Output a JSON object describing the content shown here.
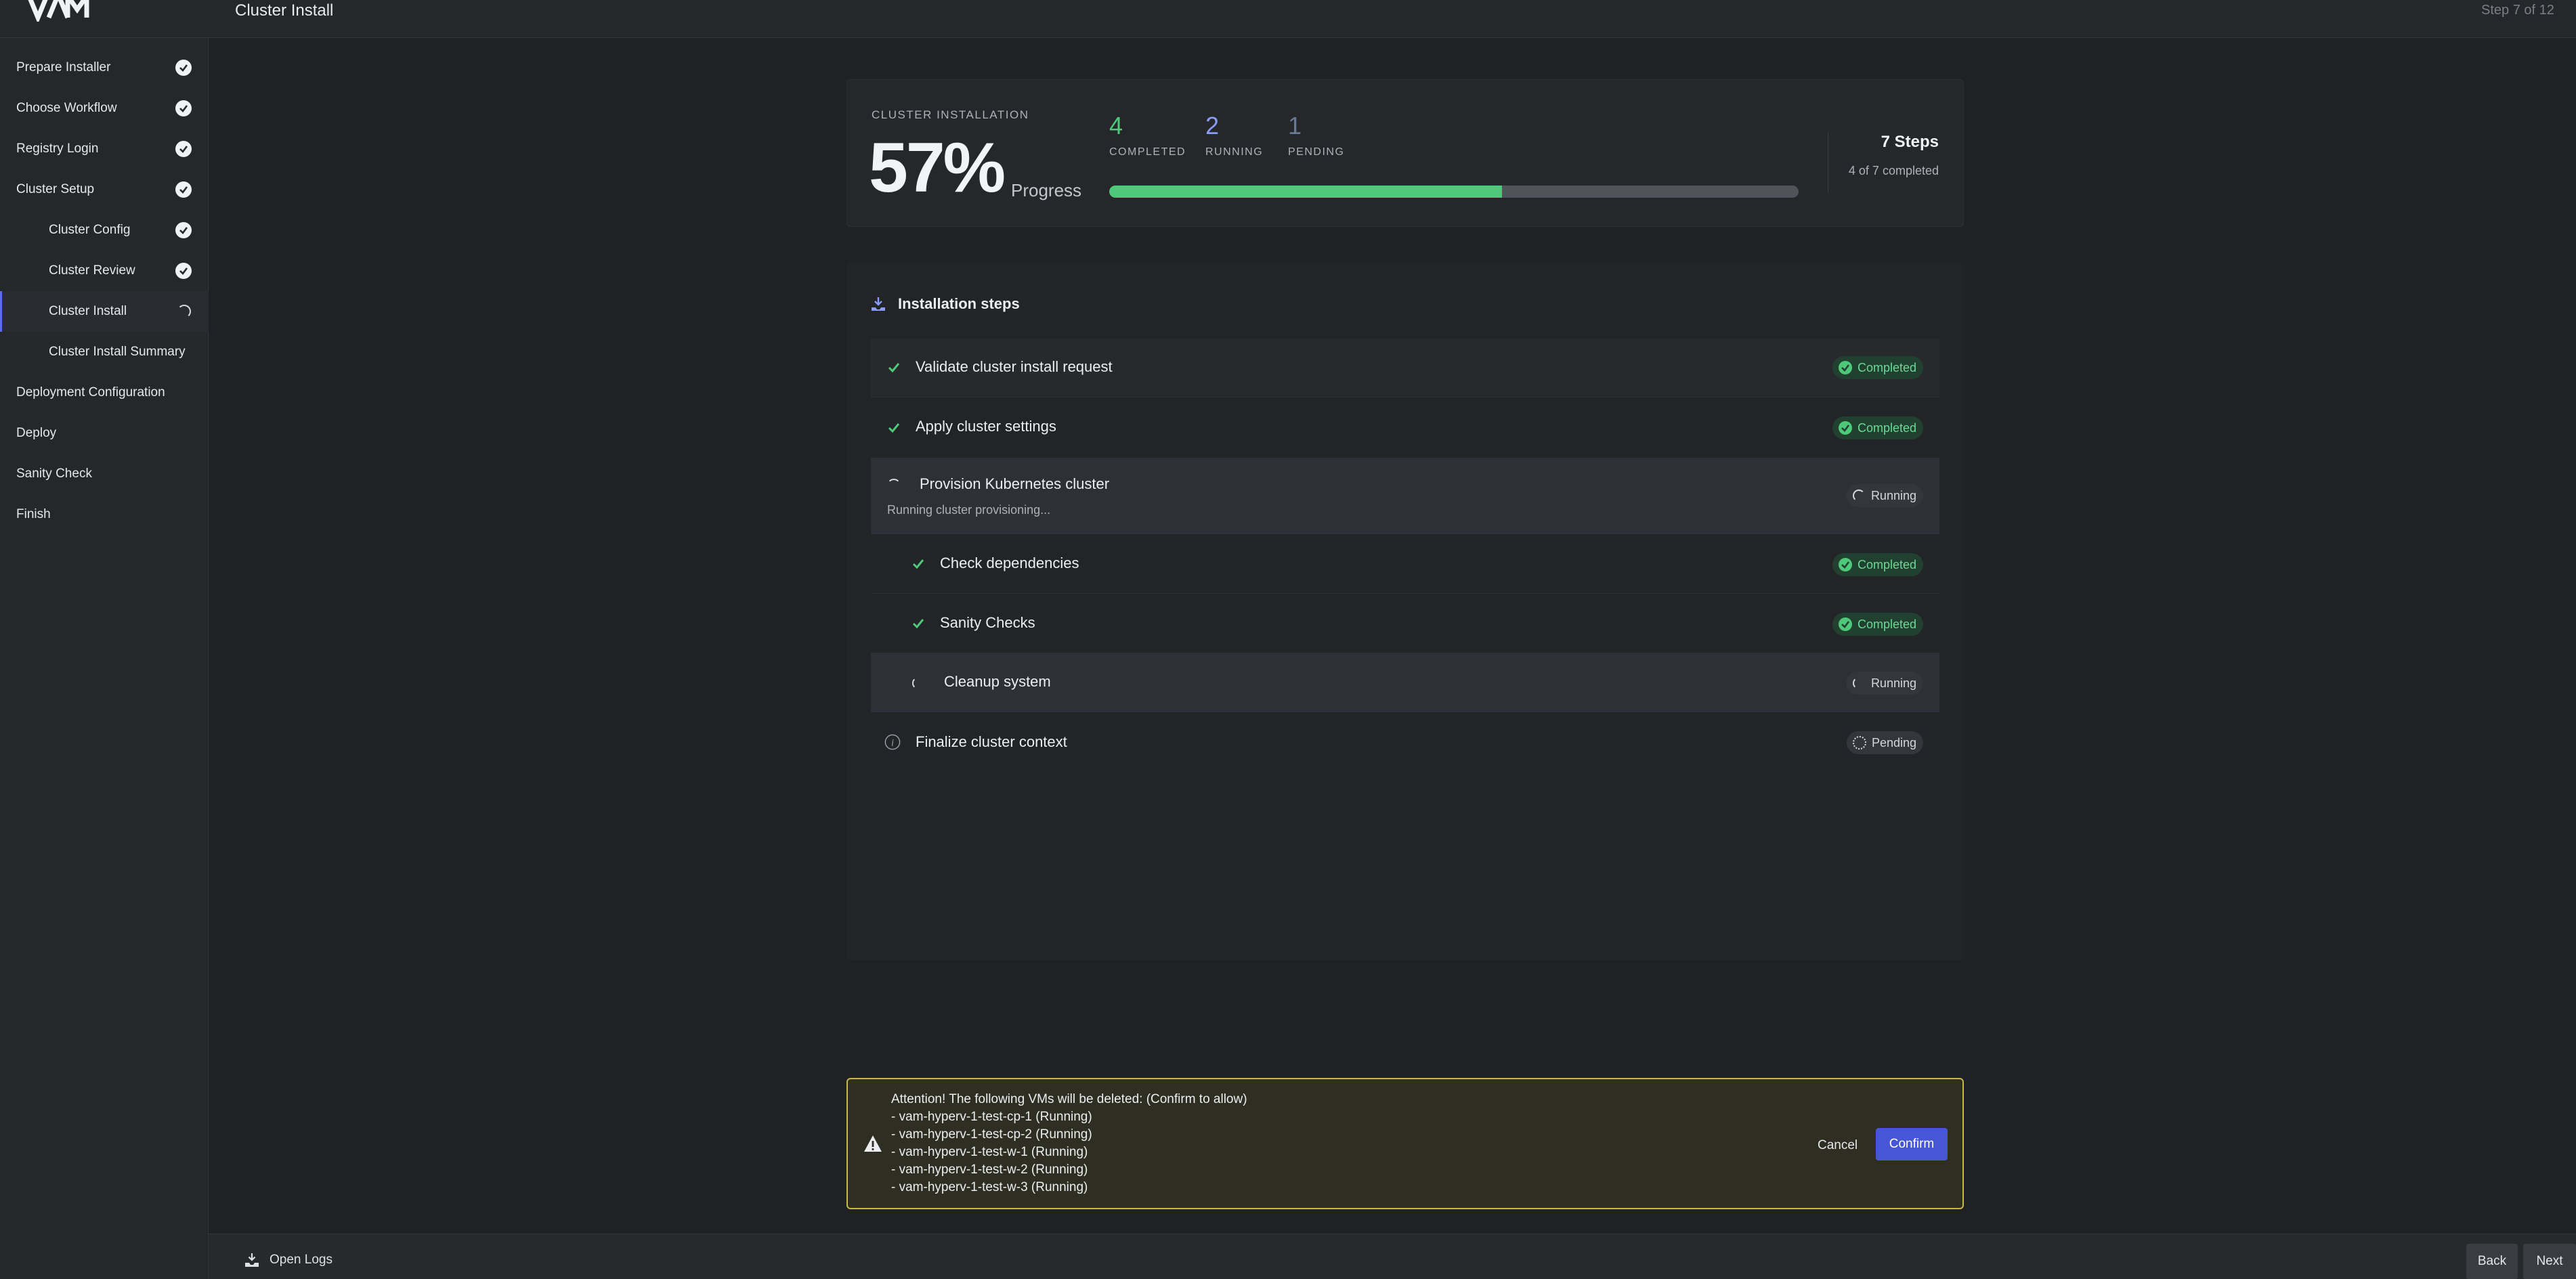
{
  "app": {
    "logo_text": "VAM"
  },
  "header": {
    "title": "Cluster Install",
    "step_counter": "Step 7 of 12"
  },
  "sidebar": {
    "items": [
      {
        "label": "Prepare Installer",
        "status": "completed"
      },
      {
        "label": "Choose Workflow",
        "status": "completed"
      },
      {
        "label": "Registry Login",
        "status": "completed"
      },
      {
        "label": "Cluster Setup",
        "status": "completed"
      },
      {
        "label": "Cluster Config",
        "status": "completed"
      },
      {
        "label": "Cluster Review",
        "status": "completed"
      },
      {
        "label": "Cluster Install",
        "status": "running"
      },
      {
        "label": "Cluster Install Summary",
        "status": "none"
      },
      {
        "label": "Deployment Configuration",
        "status": "none"
      },
      {
        "label": "Deploy",
        "status": "none"
      },
      {
        "label": "Sanity Check",
        "status": "none"
      },
      {
        "label": "Finish",
        "status": "none"
      }
    ]
  },
  "progress": {
    "eyebrow": "CLUSTER INSTALLATION",
    "percent": "57%",
    "percent_value": 57,
    "progress_word": "Progress",
    "completed_count": "4",
    "completed_label": "COMPLETED",
    "running_count": "2",
    "running_label": "RUNNING",
    "pending_count": "1",
    "pending_label": "PENDING",
    "total_steps": "7 Steps",
    "completed_summary": "4 of 7 completed"
  },
  "steps": {
    "title": "Installation steps",
    "items": [
      {
        "name": "Validate cluster install request",
        "status": "Completed"
      },
      {
        "name": "Apply cluster settings",
        "status": "Completed"
      },
      {
        "name": "Provision Kubernetes cluster",
        "status": "Running",
        "detail": "Running cluster provisioning..."
      },
      {
        "name": "Check dependencies",
        "status": "Completed"
      },
      {
        "name": "Sanity Checks",
        "status": "Completed"
      },
      {
        "name": "Cleanup system",
        "status": "Running"
      },
      {
        "name": "Finalize cluster context",
        "status": "Pending"
      }
    ]
  },
  "alert": {
    "lines": [
      "Attention! The following VMs will be deleted: (Confirm to allow)",
      "- vam-hyperv-1-test-cp-1 (Running)",
      "- vam-hyperv-1-test-cp-2 (Running)",
      "- vam-hyperv-1-test-w-1 (Running)",
      "- vam-hyperv-1-test-w-2 (Running)",
      "- vam-hyperv-1-test-w-3 (Running)"
    ],
    "cancel_label": "Cancel",
    "confirm_label": "Confirm"
  },
  "footer": {
    "open_logs_label": "Open Logs",
    "back_label": "Back",
    "next_label": "Next"
  },
  "colors": {
    "accent": "#5b6cf0",
    "success": "#4ec97a",
    "running": "#8a9cf5",
    "pending": "#6a7a95",
    "warning_border": "#c7b84a",
    "primary_button": "#4656d4"
  }
}
